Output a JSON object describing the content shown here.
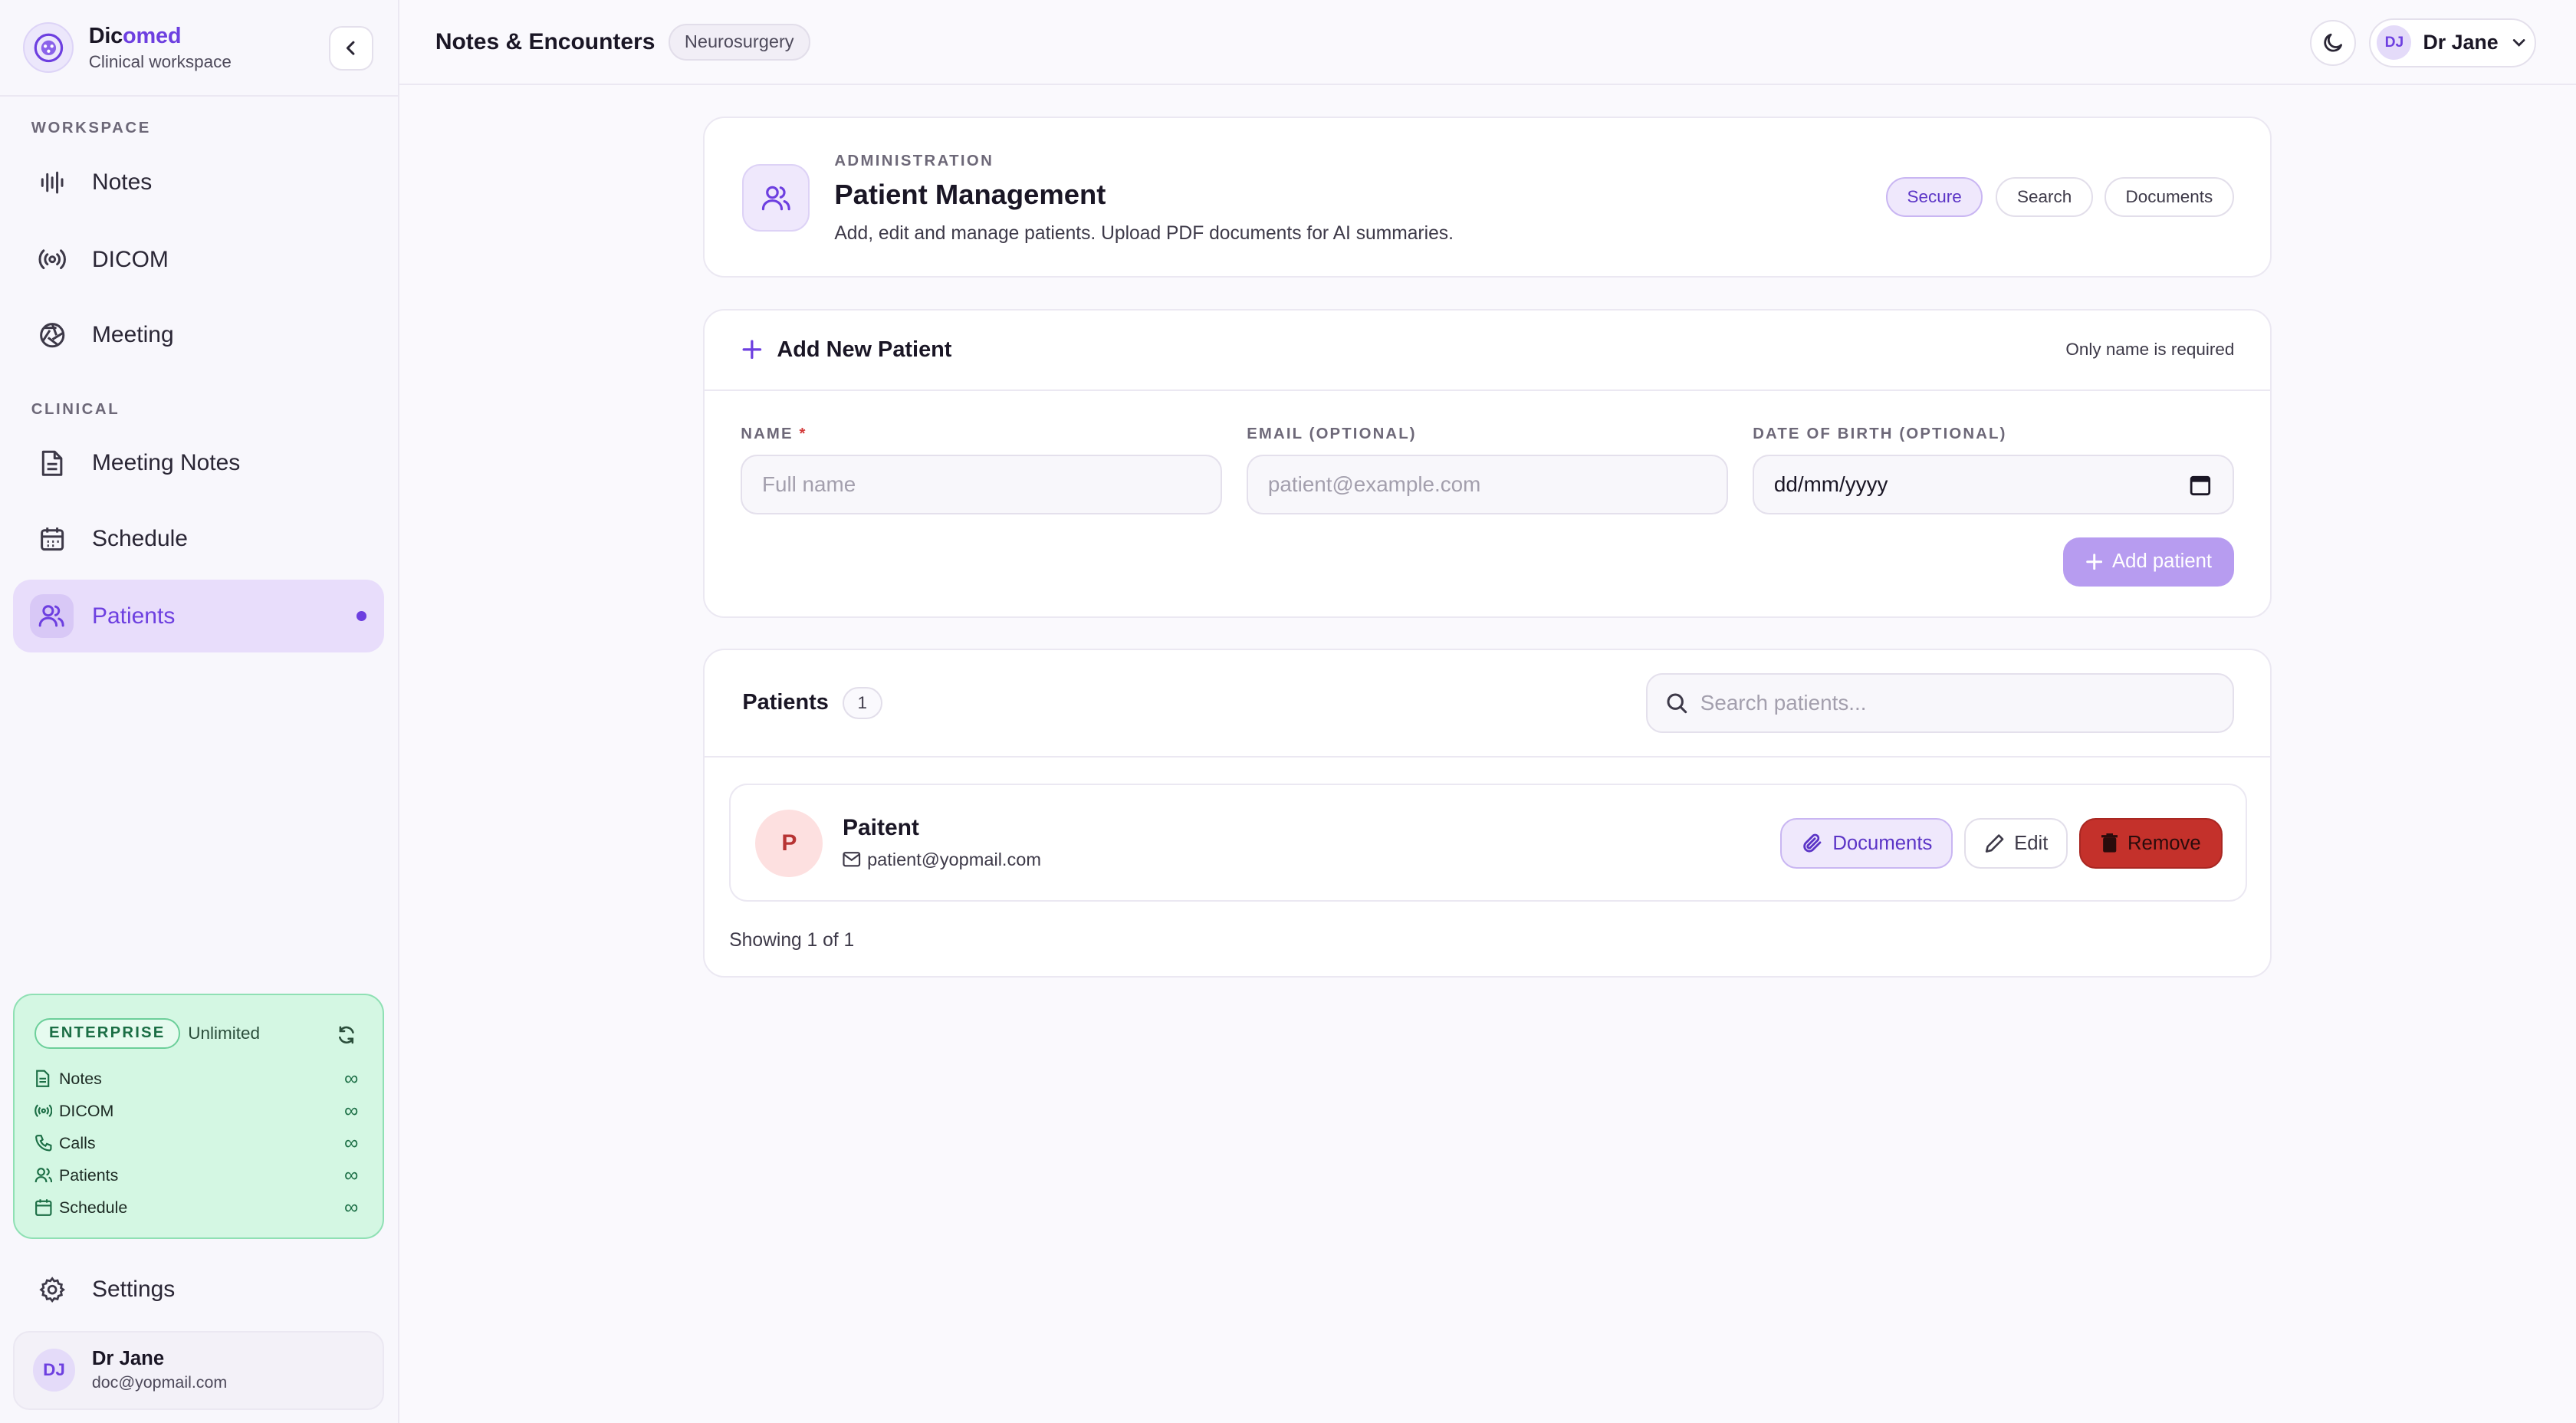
{
  "brand": {
    "name_a": "Dic",
    "name_b": "omed",
    "subtitle": "Clinical workspace"
  },
  "sidebar": {
    "workspace_label": "WORKSPACE",
    "clinical_label": "CLINICAL",
    "items": [
      {
        "label": "Notes",
        "icon": "waveform-icon"
      },
      {
        "label": "DICOM",
        "icon": "broadcast-icon"
      },
      {
        "label": "Meeting",
        "icon": "aperture-icon"
      },
      {
        "label": "Meeting Notes",
        "icon": "document-icon"
      },
      {
        "label": "Schedule",
        "icon": "calendar-icon"
      },
      {
        "label": "Patients",
        "icon": "users-icon",
        "active": true
      }
    ],
    "plan": {
      "badge": "ENTERPRISE",
      "quota": "Unlimited",
      "rows": [
        {
          "label": "Notes",
          "value": "∞"
        },
        {
          "label": "DICOM",
          "value": "∞"
        },
        {
          "label": "Calls",
          "value": "∞"
        },
        {
          "label": "Patients",
          "value": "∞"
        },
        {
          "label": "Schedule",
          "value": "∞"
        }
      ]
    },
    "settings_label": "Settings",
    "user": {
      "initials": "DJ",
      "name": "Dr Jane",
      "email": "doc@yopmail.com"
    }
  },
  "topbar": {
    "title": "Notes & Encounters",
    "chip": "Neurosurgery",
    "user_initials": "DJ",
    "user_name": "Dr Jane"
  },
  "header_card": {
    "eyebrow": "ADMINISTRATION",
    "title": "Patient Management",
    "description": "Add, edit and manage patients. Upload PDF documents for AI summaries.",
    "tags": [
      "Secure",
      "Search",
      "Documents"
    ]
  },
  "add_form": {
    "title": "Add New Patient",
    "hint": "Only name is required",
    "name_label": "NAME",
    "name_required": "*",
    "name_placeholder": "Full name",
    "email_label": "EMAIL (OPTIONAL)",
    "email_placeholder": "patient@example.com",
    "dob_label": "DATE OF BIRTH (OPTIONAL)",
    "dob_value": "dd/mm/yyyy",
    "submit_label": "Add patient"
  },
  "patients": {
    "title": "Patients",
    "count": "1",
    "search_placeholder": "Search patients...",
    "rows": [
      {
        "initial": "P",
        "name": "Paitent",
        "email": "patient@yopmail.com"
      }
    ],
    "actions": {
      "documents": "Documents",
      "edit": "Edit",
      "remove": "Remove"
    },
    "showing": "Showing 1 of 1"
  },
  "colors": {
    "accent": "#6d3fe0",
    "danger": "#c4312b",
    "plan_bg": "#d4f7e3"
  }
}
